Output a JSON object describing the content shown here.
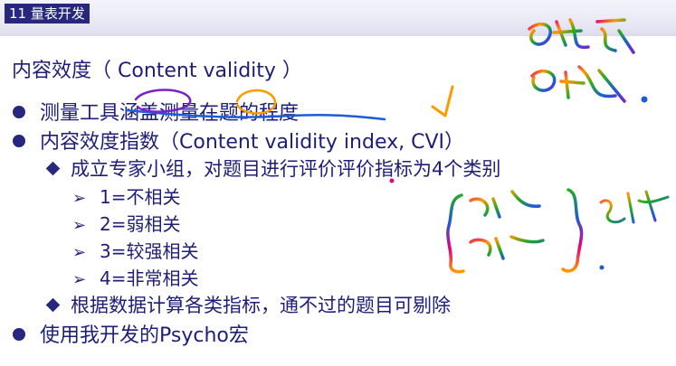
{
  "header": {
    "section_tag": "11 量表开发"
  },
  "slide": {
    "title": "内容效度（ Content validity ）",
    "bullets": [
      "测量工具涵盖测量在题的程度",
      "内容效度指数（Content validity index, CVI）",
      "使用我开发的Psycho宏"
    ],
    "sub_bullets": [
      "成立专家小组，对题目进行评价评价指标为4个类别",
      "根据数据计算各类指标，通不过的题目可剔除"
    ],
    "levels": [
      "1=不相关",
      "2=弱相关",
      "3=较强相关",
      "4=非常相关"
    ]
  },
  "colors": {
    "text": "#1e1e78",
    "bullet": "#27277e",
    "tag_bg": "#27277e",
    "ink_spectrum": [
      "#e6007e",
      "#ff9900",
      "#22aa22",
      "#1e5bd6",
      "#7a22c9"
    ]
  },
  "icons": {
    "bullet_main": "filled-circle",
    "bullet_sub": "diamond",
    "bullet_level": "arrowhead"
  }
}
